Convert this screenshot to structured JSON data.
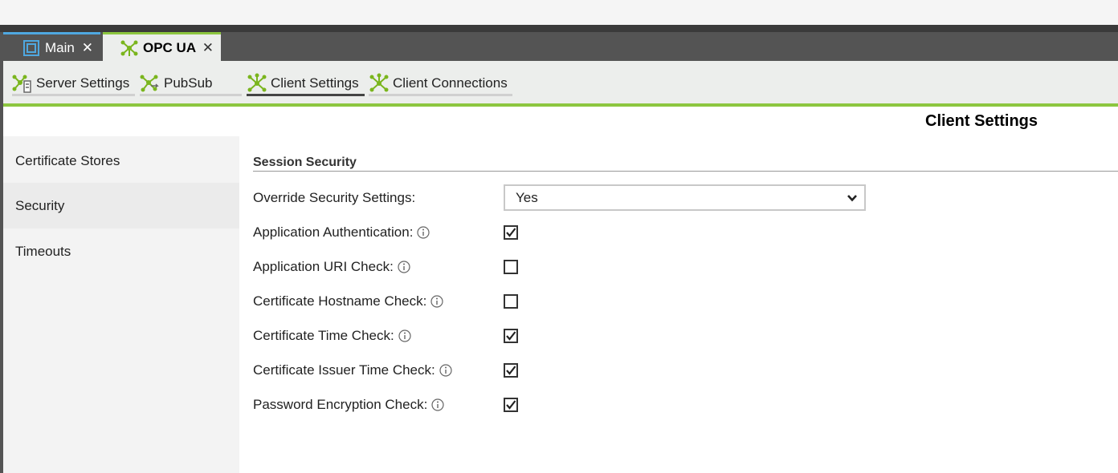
{
  "tabs": [
    {
      "label": "Main",
      "active": false,
      "icon": "window-icon"
    },
    {
      "label": "OPC UA",
      "active": true,
      "icon": "network-icon"
    }
  ],
  "toolbar": {
    "items": [
      {
        "label": "Server Settings",
        "icon": "server-network-icon",
        "active": false
      },
      {
        "label": "PubSub",
        "icon": "pubsub-network-icon",
        "active": false
      },
      {
        "label": "Client Settings",
        "icon": "network-icon",
        "active": true
      },
      {
        "label": "Client Connections",
        "icon": "network-icon",
        "active": false
      }
    ]
  },
  "page": {
    "title": "Client Settings"
  },
  "sidebar": {
    "items": [
      {
        "label": "Certificate Stores",
        "active": false
      },
      {
        "label": "Security",
        "active": true
      },
      {
        "label": "Timeouts",
        "active": false
      }
    ]
  },
  "section": {
    "title": "Session Security",
    "override": {
      "label": "Override Security Settings:",
      "value": "Yes"
    },
    "fields": [
      {
        "label": "Application Authentication:",
        "checked": true
      },
      {
        "label": "Application URI Check:",
        "checked": false
      },
      {
        "label": "Certificate Hostname Check:",
        "checked": false
      },
      {
        "label": "Certificate Time Check:",
        "checked": true
      },
      {
        "label": "Certificate Issuer Time Check:",
        "checked": true
      },
      {
        "label": "Password Encryption Check:",
        "checked": true
      }
    ]
  },
  "colors": {
    "accent": "#8cc63f",
    "tab_blue": "#4fa8e0",
    "tabbar": "#545454"
  }
}
